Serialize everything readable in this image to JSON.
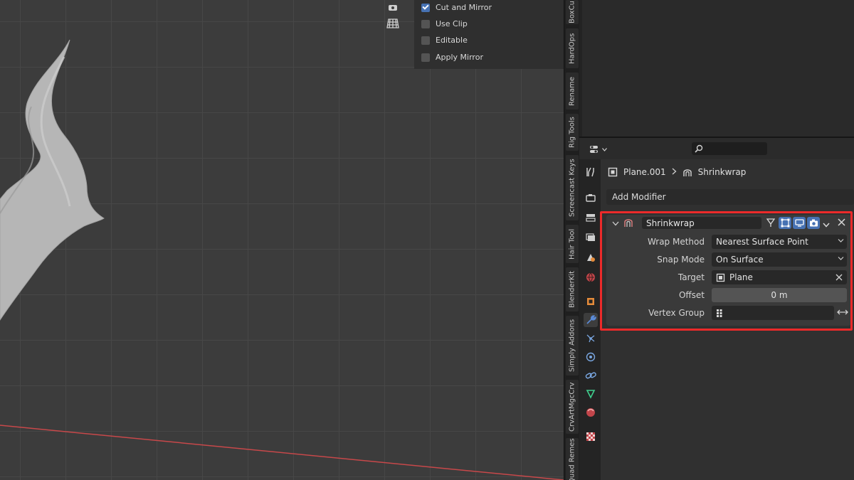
{
  "colors": {
    "accent": "#4772b3",
    "highlight": "#ec2a2a",
    "x_axis": "#c8484a",
    "mesh": "#b8b8b8"
  },
  "op_panel": {
    "options": [
      {
        "label": "Cut and Mirror",
        "checked": true
      },
      {
        "label": "Use Clip",
        "checked": false
      },
      {
        "label": "Editable",
        "checked": false
      },
      {
        "label": "Apply Mirror",
        "checked": false
      }
    ]
  },
  "n_tabs": [
    "BoxCu",
    "HardOps",
    "Rename",
    "Rig Tools",
    "Screencast Keys",
    "Hair Tool",
    "BlenderKit",
    "Simply Addons",
    "CrvArtMgcCrv",
    "Quad Remesh"
  ],
  "properties": {
    "search": {
      "placeholder": ""
    },
    "breadcrumb": {
      "object": "Plane.001",
      "modifier": "Shrinkwrap"
    },
    "add_modifier": "Add Modifier",
    "modifier": {
      "name": "Shrinkwrap",
      "wrap_method": {
        "label": "Wrap Method",
        "value": "Nearest Surface Point"
      },
      "snap_mode": {
        "label": "Snap Mode",
        "value": "On Surface"
      },
      "target": {
        "label": "Target",
        "value": "Plane"
      },
      "offset": {
        "label": "Offset",
        "value": "0 m"
      },
      "vertex_group": {
        "label": "Vertex Group",
        "value": ""
      }
    }
  }
}
